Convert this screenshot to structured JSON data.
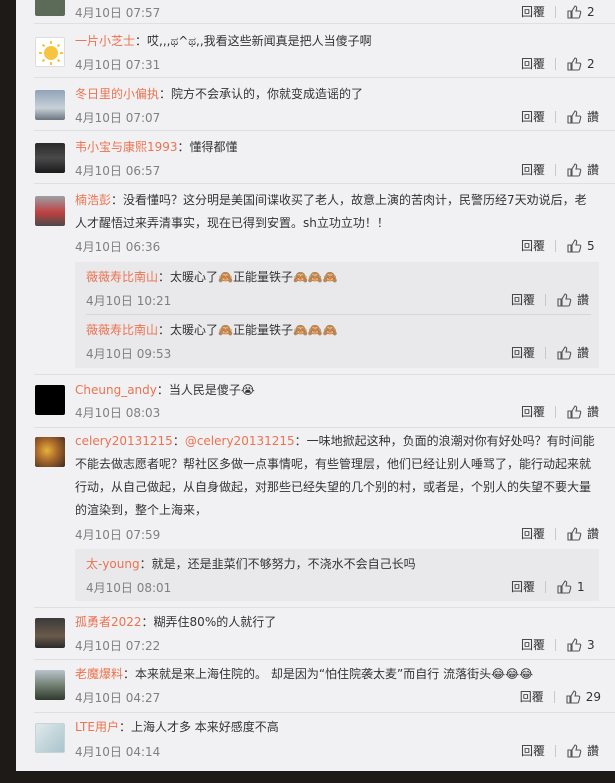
{
  "like_icon": "thumbs-up-icon",
  "comments": [
    {
      "id": 0,
      "user": "",
      "text": "",
      "time": "4月10日 07:57",
      "reply": "回覆",
      "likes": "2"
    },
    {
      "id": 1,
      "user": "一片小芝士",
      "text": "：哎,,,ಥ^ಥ,,我看这些新闻真是把人当傻子啊",
      "time": "4月10日 07:31",
      "reply": "回覆",
      "likes": "2"
    },
    {
      "id": 2,
      "user": "冬日里的小偏执",
      "text": "：院方不会承认的，你就变成造谣的了",
      "time": "4月10日 07:07",
      "reply": "回覆",
      "likes": "讚"
    },
    {
      "id": 3,
      "user": "韦小宝与康熙1993",
      "text": "：懂得都懂",
      "time": "4月10日 06:57",
      "reply": "回覆",
      "likes": "讚"
    },
    {
      "id": 4,
      "user": "楠浩彭",
      "text": "：没看懂吗？这分明是美国间谍收买了老人，故意上演的苦肉计，民警历经7天劝说后，老人才醒悟过来弄清事实，现在已得到安置。sh立功立功！！",
      "time": "4月10日 06:36",
      "reply": "回覆",
      "likes": "5",
      "replies": [
        {
          "user": "薇薇寿比南山",
          "text": "：太暖心了🙈正能量铁子🙈🙈🙈",
          "time": "4月10日 10:21",
          "reply": "回覆",
          "likes": "讚"
        },
        {
          "user": "薇薇寿比南山",
          "text": "：太暖心了🙈正能量铁子🙈🙈🙈",
          "time": "4月10日 09:53",
          "reply": "回覆",
          "likes": "讚"
        }
      ]
    },
    {
      "id": 5,
      "user": "Cheung_andy",
      "text": "：当人民是傻子😭",
      "time": "4月10日 08:03",
      "reply": "回覆",
      "likes": "讚"
    },
    {
      "id": 6,
      "user": "celery20131215",
      "mention": "@celery20131215",
      "text": "：一味地掀起这种，负面的浪潮对你有好处吗？有时间能不能去做志愿者呢？帮社区多做一点事情呢，有些管理层，他们已经让别人唾骂了，能行动起来就行动，从自己做起，从自身做起，对那些已经失望的几个别的村，或者是，个别人的失望不要大量的渲染到，整个上海来，",
      "time": "4月10日 07:59",
      "reply": "回覆",
      "likes": "讚",
      "replies": [
        {
          "user": "太-young",
          "text": "：就是，还是韭菜们不够努力，不浇水不会自己长吗",
          "time": "4月10日 08:01",
          "reply": "回覆",
          "likes": "1"
        }
      ]
    },
    {
      "id": 7,
      "user": "孤勇者2022",
      "text": "：糊弄住80%的人就行了",
      "time": "4月10日 07:22",
      "reply": "回覆",
      "likes": "3"
    },
    {
      "id": 8,
      "user": "老魔爆料",
      "text": "：本来就是来上海住院的。 却是因为“怕住院袭太麦”而自行 流落街头😂😂😂",
      "time": "4月10日 04:27",
      "reply": "回覆",
      "likes": "29"
    },
    {
      "id": 9,
      "user": "LTE用户",
      "text": "：上海人才多 本来好感度不高",
      "time": "4月10日 04:14",
      "reply": "回覆",
      "likes": "讚"
    }
  ]
}
